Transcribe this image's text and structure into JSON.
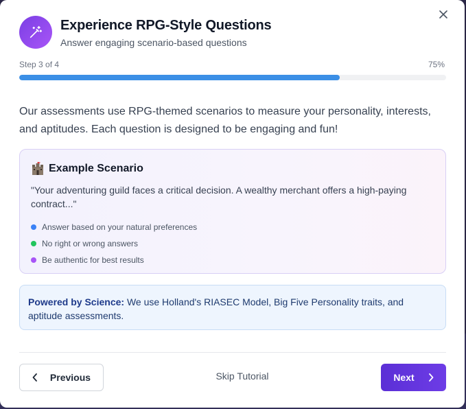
{
  "modal": {
    "title": "Experience RPG-Style Questions",
    "subtitle": "Answer engaging scenario-based questions",
    "header_icon": "magic-wand-icon",
    "close_icon": "close-icon"
  },
  "progress": {
    "step_label": "Step 3 of 4",
    "percent_label": "75%",
    "fraction": 0.75,
    "color": "#3b8fe6"
  },
  "description": "Our assessments use RPG-themed scenarios to measure your personality, interests, and aptitudes. Each question is designed to be engaging and fun!",
  "scenario": {
    "icon": "castle-icon",
    "heading": "Example Scenario",
    "quote": "\"Your adventuring guild faces a critical decision. A wealthy merchant offers a high-paying contract...\"",
    "tips": [
      {
        "text": "Answer based on your natural preferences",
        "color": "#3b82f6"
      },
      {
        "text": "No right or wrong answers",
        "color": "#22c55e"
      },
      {
        "text": "Be authentic for best results",
        "color": "#a855f7"
      }
    ]
  },
  "science": {
    "label": "Powered by Science:",
    "text": " We use Holland's RIASEC Model, Big Five Personality traits, and aptitude assessments."
  },
  "footer": {
    "previous_label": "Previous",
    "skip_label": "Skip Tutorial",
    "next_label": "Next"
  },
  "colors": {
    "accent": "#6d3ce6",
    "progress": "#3b8fe6"
  }
}
